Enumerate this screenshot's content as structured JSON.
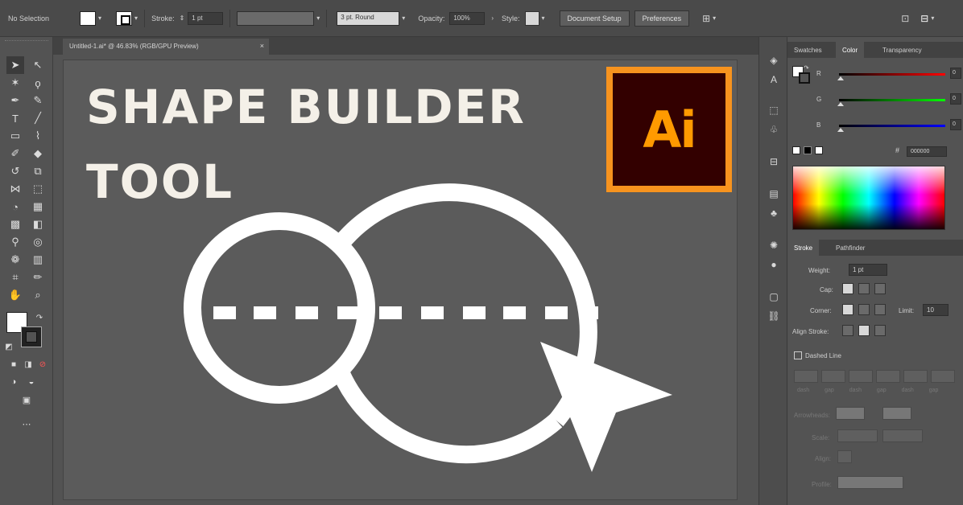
{
  "control_bar": {
    "selection_label": "No Selection",
    "stroke_label": "Stroke:",
    "stroke_weight": "1 pt",
    "brush_profile": "3 pt. Round",
    "opacity_label": "Opacity:",
    "opacity_value": "100%",
    "style_label": "Style:",
    "document_setup": "Document Setup",
    "preferences": "Preferences"
  },
  "document": {
    "tab_title": "Untitled-1.ai* @ 46.83% (RGB/GPU Preview)",
    "close_glyph": "×"
  },
  "artwork": {
    "title_line1": "SHAPE BUILDER",
    "title_line2": "TOOL",
    "logo_text": "Ai",
    "logo_border_color": "#f7931e",
    "logo_bg_color": "#330000"
  },
  "right_panel": {
    "tabs": [
      "Swatches",
      "Color",
      "Transparency"
    ],
    "active_tab": "Color",
    "sliders": [
      {
        "channel": "R",
        "value": "0"
      },
      {
        "channel": "G",
        "value": "0"
      },
      {
        "channel": "B",
        "value": "0"
      }
    ],
    "hex_value": "000000",
    "stroke_tabs": [
      "Stroke",
      "Pathfinder"
    ],
    "weight_label": "Weight:",
    "weight_value": "1 pt",
    "cap_label": "Cap:",
    "corner_label": "Corner:",
    "limit_label": "Limit:",
    "limit_value": "10",
    "align_label": "Align Stroke:",
    "dashed_label": "Dashed Line",
    "dash_labels": [
      "dash",
      "gap",
      "dash",
      "gap",
      "dash",
      "gap"
    ],
    "arrowheads_label": "Arrowheads:",
    "scale_label": "Scale:",
    "align_arrow_label": "Align:",
    "profile_label": "Profile:"
  },
  "icons": [
    "selection-tool-icon",
    "direct-selection-icon",
    "magic-wand-icon",
    "lasso-icon",
    "pen-icon",
    "curvature-icon",
    "type-icon",
    "line-icon",
    "rectangle-icon",
    "paintbrush-icon",
    "pencil-icon",
    "eraser-icon",
    "rotate-icon",
    "scale-icon",
    "width-icon",
    "free-transform-icon",
    "shape-builder-icon",
    "perspective-icon",
    "mesh-icon",
    "gradient-icon",
    "eyedropper-icon",
    "blend-icon",
    "symbol-sprayer-icon",
    "column-graph-icon",
    "artboard-icon",
    "slice-icon",
    "hand-icon",
    "zoom-icon"
  ]
}
